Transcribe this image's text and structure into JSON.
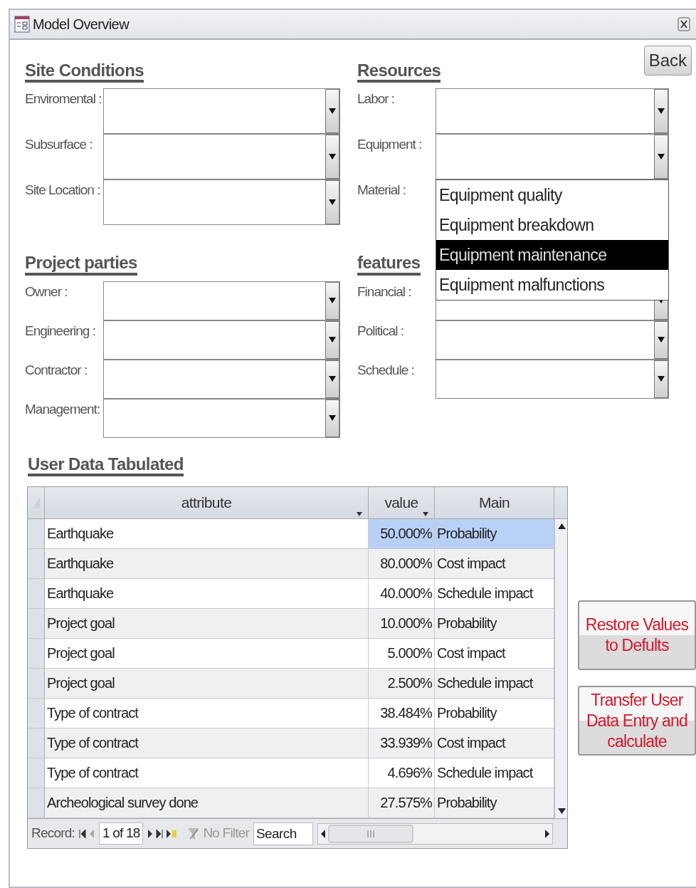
{
  "window": {
    "title": "Model Overview"
  },
  "back_button": "Back",
  "sections": [
    {
      "title": "Site Conditions",
      "fields": [
        {
          "label": "Enviromental :"
        },
        {
          "label": "Subsurface :"
        },
        {
          "label": "Site Location :"
        }
      ]
    },
    {
      "title": "Resources",
      "fields": [
        {
          "label": "Labor  :"
        },
        {
          "label": "Equipment :"
        },
        {
          "label": "Material  :",
          "open_list": [
            {
              "label": "Equipment quality",
              "selected": false
            },
            {
              "label": "Equipment breakdown",
              "selected": false
            },
            {
              "label": "Equipment maintenance",
              "selected": true
            },
            {
              "label": "Equipment malfunctions",
              "selected": false
            }
          ]
        }
      ]
    },
    {
      "title": "Project parties",
      "fields": [
        {
          "label": "Owner  :"
        },
        {
          "label": "Engineering :"
        },
        {
          "label": "Contractor  :"
        },
        {
          "label": "Management:"
        }
      ]
    },
    {
      "title": "features",
      "fields": [
        {
          "label": "Financial  :"
        },
        {
          "label": "Political :"
        },
        {
          "label": "Schedule :"
        }
      ]
    }
  ],
  "table": {
    "title": "User Data Tabulated",
    "columns": [
      {
        "label": "attribute",
        "filter": true
      },
      {
        "label": "value",
        "filter": true
      },
      {
        "label": "Main",
        "filter": false
      }
    ],
    "rows": [
      {
        "attribute": "Earthquake",
        "value": "50.000%",
        "main": "Probability",
        "selected": true
      },
      {
        "attribute": "Earthquake",
        "value": "80.000%",
        "main": "Cost impact",
        "selected": false
      },
      {
        "attribute": "Earthquake",
        "value": "40.000%",
        "main": "Schedule impact",
        "selected": false
      },
      {
        "attribute": "Project goal",
        "value": "10.000%",
        "main": "Probability",
        "selected": false
      },
      {
        "attribute": "Project goal",
        "value": "5.000%",
        "main": "Cost impact",
        "selected": false
      },
      {
        "attribute": "Project goal",
        "value": "2.500%",
        "main": "Schedule impact",
        "selected": false
      },
      {
        "attribute": "Type of contract",
        "value": "38.484%",
        "main": "Probability",
        "selected": false
      },
      {
        "attribute": "Type of contract",
        "value": "33.939%",
        "main": "Cost impact",
        "selected": false
      },
      {
        "attribute": "Type of contract",
        "value": "4.696%",
        "main": "Schedule impact",
        "selected": false
      },
      {
        "attribute": "Archeological survey done",
        "value": "27.575%",
        "main": "Probability",
        "selected": false
      }
    ],
    "record_bar": {
      "label": "Record:",
      "position": "1 of 18",
      "filter": "No Filter",
      "search_placeholder": "Search"
    }
  },
  "buttons": [
    "Restore Values to Defults",
    "Transfer User Data Entry and calculate"
  ]
}
